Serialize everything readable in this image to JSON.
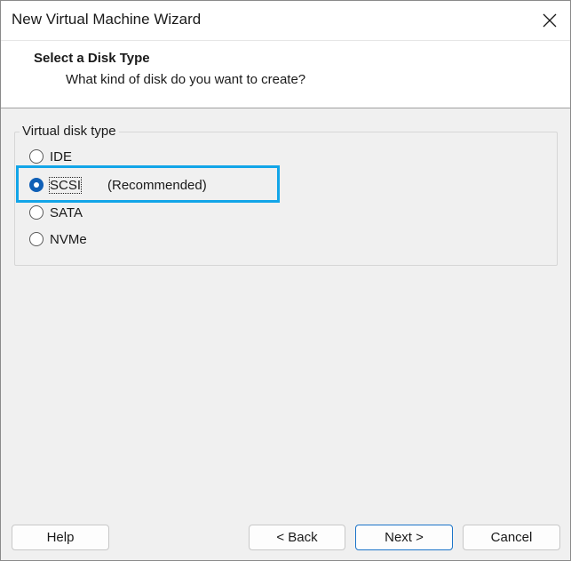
{
  "window": {
    "title": "New Virtual Machine Wizard",
    "close_icon": "close-icon"
  },
  "header": {
    "title": "Select a Disk Type",
    "subtitle": "What kind of disk do you want to create?"
  },
  "group": {
    "label": "Virtual disk type",
    "options": [
      {
        "label": "IDE",
        "checked": false
      },
      {
        "label": "SCSI",
        "checked": true,
        "note": "(Recommended)"
      },
      {
        "label": "SATA",
        "checked": false
      },
      {
        "label": "NVMe",
        "checked": false
      }
    ]
  },
  "buttons": {
    "help": "Help",
    "back": "< Back",
    "next": "Next >",
    "cancel": "Cancel"
  },
  "colors": {
    "highlight": "#12a5e8",
    "radio_checked": "#0f5fb6",
    "primary_border": "#1b74c9"
  }
}
